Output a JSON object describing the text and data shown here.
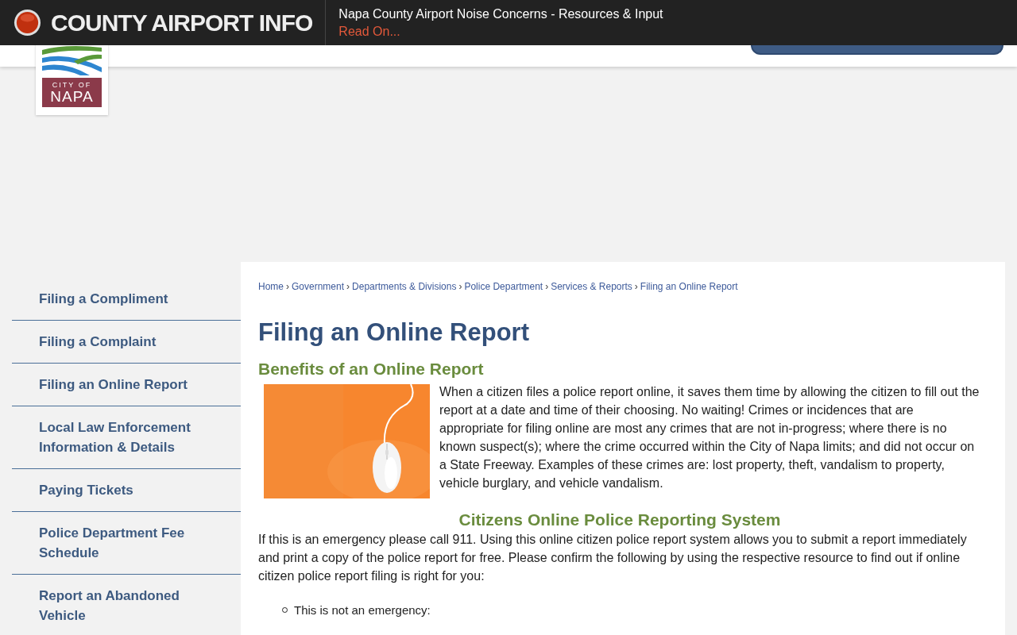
{
  "alert_bar": {
    "title": "COUNTY AIRPORT INFO",
    "message": "Napa County Airport Noise Concerns - Resources & Input",
    "link": "Read On..."
  },
  "logo": {
    "line_1": "CITY OF",
    "line_2": "NAPA"
  },
  "sidebar": {
    "items": [
      "Filing a Compliment",
      "Filing a Complaint",
      "Filing an Online Report",
      "Local Law Enforcement Information & Details",
      "Paying Tickets",
      "Police Department Fee Schedule",
      "Report an Abandoned Vehicle"
    ]
  },
  "breadcrumbs": [
    "Home",
    "Government",
    "Departments & Divisions",
    "Police Department",
    "Services & Reports",
    "Filing an Online Report"
  ],
  "breadcrumb_separator": "›",
  "page_title": "Filing an Online Report",
  "section_1": {
    "heading": "Benefits of an Online Report",
    "text": "When a citizen files a police report online, it saves them time by allowing the citizen to fill out the report at a date and time of their choosing. No waiting! Crimes or incidences that are appropriate for filing online are most any crimes that are not in-progress; where there is no known suspect(s); where the crime occurred within the City of Napa limits; and did not occur on a State Freeway. Examples of these crimes are: lost property, theft, vandalism to property, vehicle burglary, and vehicle vandalism."
  },
  "section_2": {
    "heading": "Citizens Online Police Reporting System",
    "text": "If this is an emergency please call 911. Using this online citizen police report system allows you to submit a report immediately and print a copy of the police report for free. Please confirm the following by using the respective resource to find out if online citizen police report filing is right for you:",
    "list": [
      "This is not an emergency:"
    ]
  }
}
